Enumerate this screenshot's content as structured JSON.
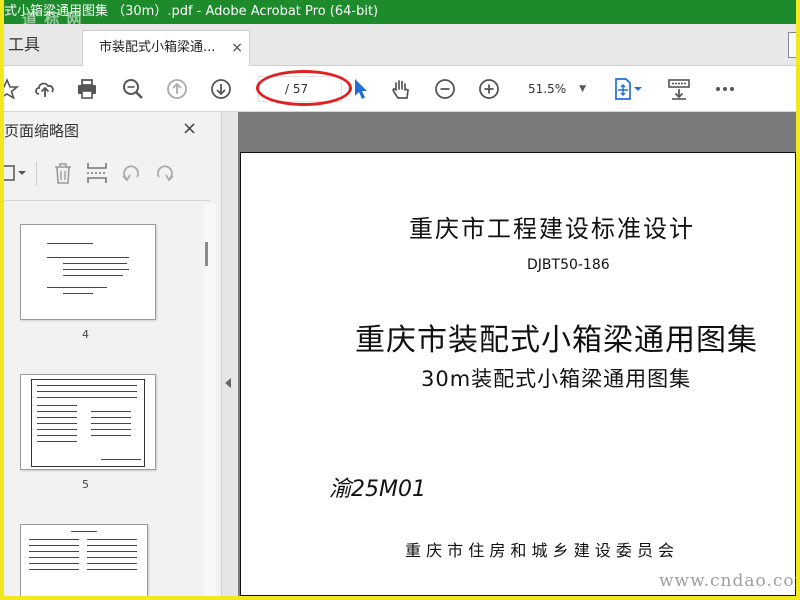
{
  "titlebar": {
    "title": "式小箱梁通用图集 （30m）.pdf - Adobe Acrobat Pro (64-bit)",
    "watermark": "道 标 网"
  },
  "tabs": {
    "tools_label": "工具",
    "doc_tab_label": "市装配式小箱梁通...",
    "doc_tab_close": "×"
  },
  "toolbar": {
    "page_current": "",
    "page_total": "/ 57",
    "zoom": "51.5%",
    "zoom_caret": "▼",
    "annotation_color": "#e02020",
    "icons": [
      "star-icon",
      "upload-icon",
      "print-icon",
      "zoom-search-icon",
      "prev-page-icon",
      "next-page-icon",
      "select-arrow-icon",
      "hand-tool-icon",
      "zoom-out-icon",
      "zoom-in-icon",
      "fit-page-icon",
      "scroll-mode-icon",
      "more-icon"
    ]
  },
  "leftpane": {
    "title": "页面缩略图",
    "close": "×",
    "tool_icons": [
      "options-icon",
      "trash-icon",
      "insert-page-icon",
      "undo-icon",
      "redo-icon"
    ],
    "thumbnails": [
      {
        "label": "4"
      },
      {
        "label": "5"
      },
      {
        "label": ""
      }
    ]
  },
  "document": {
    "line1": "重庆市工程建设标准设计",
    "line2": "DJBT50-186",
    "line3": "重庆市装配式小箱梁通用图集",
    "line4": "30m装配式小箱梁通用图集",
    "line5": "渝25M01",
    "line6": "重 庆 市 住 房 和 城 乡 建 设 委 员 会",
    "watermark": "www.cndao.com"
  }
}
